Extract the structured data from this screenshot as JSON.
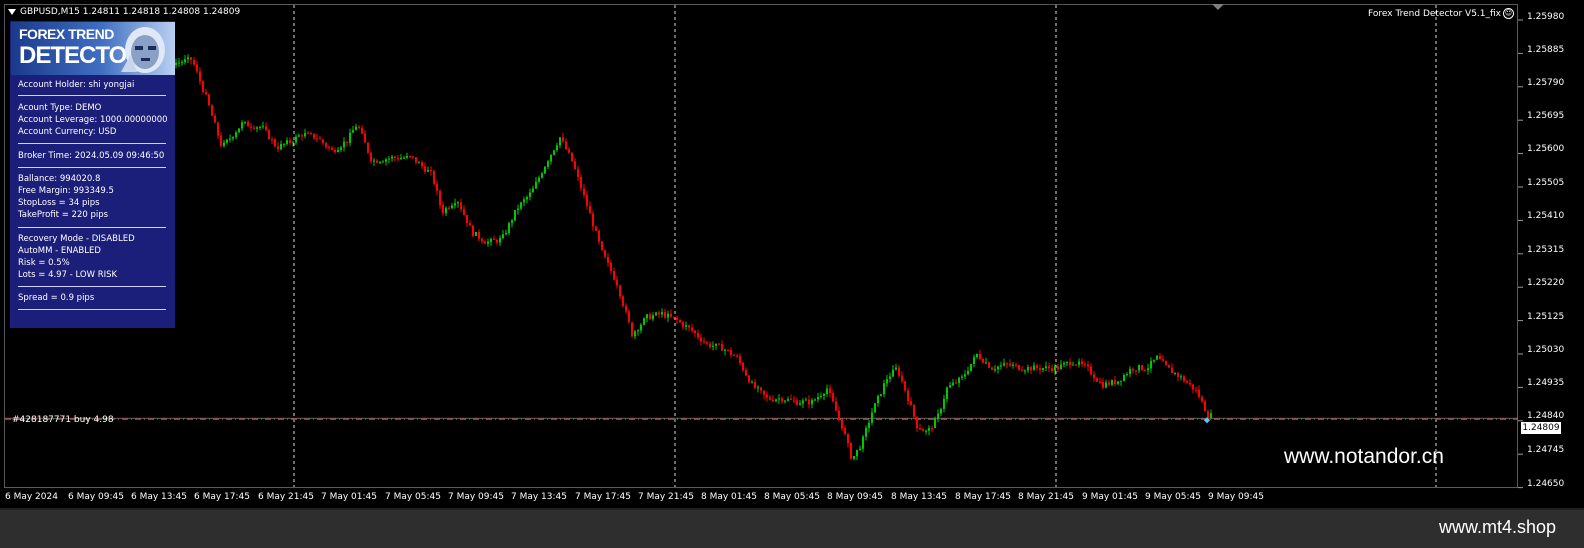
{
  "header": {
    "symbol_info": "GBPUSD,M15  1.24811 1.24818 1.24808 1.24809",
    "ea_title": "Forex Trend Detector V5.1_fix"
  },
  "panel": {
    "logo_line1": "FOREX TREND",
    "logo_line2": "DETECTOR",
    "account_holder": "Account Holder: shi yongjai",
    "account_type": "Acount Type:  DEMO",
    "leverage": "Account Leverage: 1000.00000000",
    "currency": "Account Currency: USD",
    "broker_time": "Broker Time: 2024.05.09 09:46:50",
    "balance": "Ballance: 994020.8",
    "free_margin": "Free Margin: 993349.5",
    "stoploss": "StopLoss = 34 pips",
    "takeprofit": "TakeProfit = 220 pips",
    "recovery": "Recovery Mode - DISABLED",
    "automm": "AutoMM - ENABLED",
    "risk": "Risk = 0.5%",
    "lots": "Lots = 4.97 - LOW RISK",
    "spread": "Spread = 0.9 pips"
  },
  "price_axis": [
    "1.25980",
    "1.25885",
    "1.25790",
    "1.25695",
    "1.25600",
    "1.25505",
    "1.25410",
    "1.25315",
    "1.25220",
    "1.25125",
    "1.25030",
    "1.24935",
    "1.24840",
    "1.24745",
    "1.24650"
  ],
  "current_price": "1.24809",
  "time_axis": [
    "6 May 2024",
    "6 May 09:45",
    "6 May 13:45",
    "6 May 17:45",
    "6 May 21:45",
    "7 May 01:45",
    "7 May 05:45",
    "7 May 09:45",
    "7 May 13:45",
    "7 May 17:45",
    "7 May 21:45",
    "8 May 01:45",
    "8 May 05:45",
    "8 May 09:45",
    "8 May 13:45",
    "8 May 17:45",
    "8 May 21:45",
    "9 May 01:45",
    "9 May 05:45",
    "9 May 09:45"
  ],
  "order_label": "#428187771 buy 4.98",
  "watermark": "www.notandor.cn",
  "footer_site": "www.mt4.shop",
  "colors": {
    "bull": "#00c800",
    "bear": "#ff0000",
    "panel": "#1c1f7a",
    "order_line": "#ff3030"
  },
  "chart_data": {
    "type": "line",
    "title": "",
    "ylim": [
      1.24615,
      1.25995
    ],
    "price_path": [
      [
        0,
        1.2555
      ],
      [
        20,
        1.2549
      ],
      [
        45,
        1.255
      ],
      [
        60,
        1.257
      ],
      [
        80,
        1.258
      ],
      [
        100,
        1.2583
      ],
      [
        120,
        1.2582
      ],
      [
        140,
        1.2581
      ],
      [
        160,
        1.2586
      ],
      [
        175,
        1.2586
      ],
      [
        190,
        1.2587
      ],
      [
        205,
        1.2575
      ],
      [
        220,
        1.2561
      ],
      [
        240,
        1.2568
      ],
      [
        260,
        1.2567
      ],
      [
        275,
        1.2561
      ],
      [
        290,
        1.2563
      ],
      [
        300,
        1.2565
      ],
      [
        315,
        1.2564
      ],
      [
        330,
        1.256
      ],
      [
        345,
        1.2563
      ],
      [
        355,
        1.2568
      ],
      [
        370,
        1.2557
      ],
      [
        390,
        1.2558
      ],
      [
        410,
        1.2558
      ],
      [
        430,
        1.2553
      ],
      [
        440,
        1.2542
      ],
      [
        455,
        1.2546
      ],
      [
        470,
        1.2536
      ],
      [
        485,
        1.2533
      ],
      [
        500,
        1.2534
      ],
      [
        515,
        1.2543
      ],
      [
        530,
        1.2548
      ],
      [
        545,
        1.2557
      ],
      [
        558,
        1.2564
      ],
      [
        570,
        1.2557
      ],
      [
        585,
        1.2544
      ],
      [
        600,
        1.253
      ],
      [
        615,
        1.2521
      ],
      [
        630,
        1.2506
      ],
      [
        645,
        1.2511
      ],
      [
        660,
        1.2512
      ],
      [
        675,
        1.251
      ],
      [
        690,
        1.2507
      ],
      [
        705,
        1.2503
      ],
      [
        720,
        1.2502
      ],
      [
        735,
        1.2499
      ],
      [
        750,
        1.2491
      ],
      [
        765,
        1.2487
      ],
      [
        780,
        1.2487
      ],
      [
        795,
        1.2486
      ],
      [
        810,
        1.2486
      ],
      [
        825,
        1.249
      ],
      [
        840,
        1.2479
      ],
      [
        850,
        1.2469
      ],
      [
        860,
        1.2474
      ],
      [
        870,
        1.2483
      ],
      [
        885,
        1.2493
      ],
      [
        895,
        1.2496
      ],
      [
        905,
        1.2488
      ],
      [
        915,
        1.2479
      ],
      [
        925,
        1.2477
      ],
      [
        935,
        1.2481
      ],
      [
        945,
        1.249
      ],
      [
        960,
        1.2493
      ],
      [
        975,
        1.25
      ],
      [
        990,
        1.2496
      ],
      [
        1005,
        1.2497
      ],
      [
        1020,
        1.2496
      ],
      [
        1035,
        1.2496
      ],
      [
        1055,
        1.2496
      ],
      [
        1070,
        1.2498
      ],
      [
        1085,
        1.2496
      ],
      [
        1100,
        1.2491
      ],
      [
        1115,
        1.2492
      ],
      [
        1130,
        1.2496
      ],
      [
        1145,
        1.2496
      ],
      [
        1155,
        1.2499
      ],
      [
        1165,
        1.2496
      ],
      [
        1180,
        1.2493
      ],
      [
        1195,
        1.2489
      ],
      [
        1206,
        1.2482
      ]
    ],
    "current_price": 1.24809
  }
}
